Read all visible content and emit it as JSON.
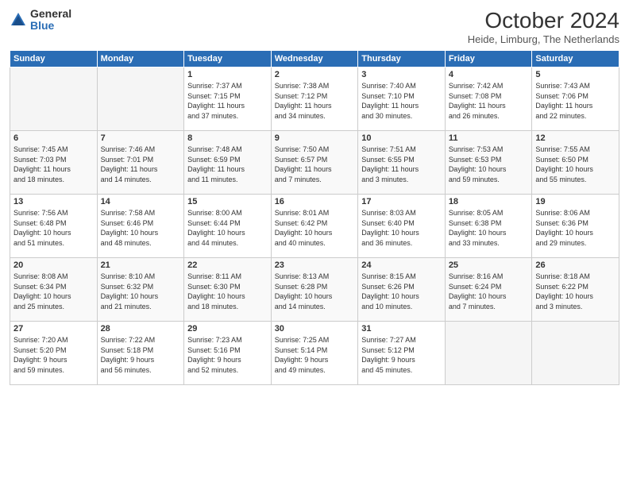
{
  "logo": {
    "general": "General",
    "blue": "Blue"
  },
  "title": "October 2024",
  "subtitle": "Heide, Limburg, The Netherlands",
  "headers": [
    "Sunday",
    "Monday",
    "Tuesday",
    "Wednesday",
    "Thursday",
    "Friday",
    "Saturday"
  ],
  "weeks": [
    [
      {
        "day": "",
        "info": ""
      },
      {
        "day": "",
        "info": ""
      },
      {
        "day": "1",
        "info": "Sunrise: 7:37 AM\nSunset: 7:15 PM\nDaylight: 11 hours\nand 37 minutes."
      },
      {
        "day": "2",
        "info": "Sunrise: 7:38 AM\nSunset: 7:12 PM\nDaylight: 11 hours\nand 34 minutes."
      },
      {
        "day": "3",
        "info": "Sunrise: 7:40 AM\nSunset: 7:10 PM\nDaylight: 11 hours\nand 30 minutes."
      },
      {
        "day": "4",
        "info": "Sunrise: 7:42 AM\nSunset: 7:08 PM\nDaylight: 11 hours\nand 26 minutes."
      },
      {
        "day": "5",
        "info": "Sunrise: 7:43 AM\nSunset: 7:06 PM\nDaylight: 11 hours\nand 22 minutes."
      }
    ],
    [
      {
        "day": "6",
        "info": "Sunrise: 7:45 AM\nSunset: 7:03 PM\nDaylight: 11 hours\nand 18 minutes."
      },
      {
        "day": "7",
        "info": "Sunrise: 7:46 AM\nSunset: 7:01 PM\nDaylight: 11 hours\nand 14 minutes."
      },
      {
        "day": "8",
        "info": "Sunrise: 7:48 AM\nSunset: 6:59 PM\nDaylight: 11 hours\nand 11 minutes."
      },
      {
        "day": "9",
        "info": "Sunrise: 7:50 AM\nSunset: 6:57 PM\nDaylight: 11 hours\nand 7 minutes."
      },
      {
        "day": "10",
        "info": "Sunrise: 7:51 AM\nSunset: 6:55 PM\nDaylight: 11 hours\nand 3 minutes."
      },
      {
        "day": "11",
        "info": "Sunrise: 7:53 AM\nSunset: 6:53 PM\nDaylight: 10 hours\nand 59 minutes."
      },
      {
        "day": "12",
        "info": "Sunrise: 7:55 AM\nSunset: 6:50 PM\nDaylight: 10 hours\nand 55 minutes."
      }
    ],
    [
      {
        "day": "13",
        "info": "Sunrise: 7:56 AM\nSunset: 6:48 PM\nDaylight: 10 hours\nand 51 minutes."
      },
      {
        "day": "14",
        "info": "Sunrise: 7:58 AM\nSunset: 6:46 PM\nDaylight: 10 hours\nand 48 minutes."
      },
      {
        "day": "15",
        "info": "Sunrise: 8:00 AM\nSunset: 6:44 PM\nDaylight: 10 hours\nand 44 minutes."
      },
      {
        "day": "16",
        "info": "Sunrise: 8:01 AM\nSunset: 6:42 PM\nDaylight: 10 hours\nand 40 minutes."
      },
      {
        "day": "17",
        "info": "Sunrise: 8:03 AM\nSunset: 6:40 PM\nDaylight: 10 hours\nand 36 minutes."
      },
      {
        "day": "18",
        "info": "Sunrise: 8:05 AM\nSunset: 6:38 PM\nDaylight: 10 hours\nand 33 minutes."
      },
      {
        "day": "19",
        "info": "Sunrise: 8:06 AM\nSunset: 6:36 PM\nDaylight: 10 hours\nand 29 minutes."
      }
    ],
    [
      {
        "day": "20",
        "info": "Sunrise: 8:08 AM\nSunset: 6:34 PM\nDaylight: 10 hours\nand 25 minutes."
      },
      {
        "day": "21",
        "info": "Sunrise: 8:10 AM\nSunset: 6:32 PM\nDaylight: 10 hours\nand 21 minutes."
      },
      {
        "day": "22",
        "info": "Sunrise: 8:11 AM\nSunset: 6:30 PM\nDaylight: 10 hours\nand 18 minutes."
      },
      {
        "day": "23",
        "info": "Sunrise: 8:13 AM\nSunset: 6:28 PM\nDaylight: 10 hours\nand 14 minutes."
      },
      {
        "day": "24",
        "info": "Sunrise: 8:15 AM\nSunset: 6:26 PM\nDaylight: 10 hours\nand 10 minutes."
      },
      {
        "day": "25",
        "info": "Sunrise: 8:16 AM\nSunset: 6:24 PM\nDaylight: 10 hours\nand 7 minutes."
      },
      {
        "day": "26",
        "info": "Sunrise: 8:18 AM\nSunset: 6:22 PM\nDaylight: 10 hours\nand 3 minutes."
      }
    ],
    [
      {
        "day": "27",
        "info": "Sunrise: 7:20 AM\nSunset: 5:20 PM\nDaylight: 9 hours\nand 59 minutes."
      },
      {
        "day": "28",
        "info": "Sunrise: 7:22 AM\nSunset: 5:18 PM\nDaylight: 9 hours\nand 56 minutes."
      },
      {
        "day": "29",
        "info": "Sunrise: 7:23 AM\nSunset: 5:16 PM\nDaylight: 9 hours\nand 52 minutes."
      },
      {
        "day": "30",
        "info": "Sunrise: 7:25 AM\nSunset: 5:14 PM\nDaylight: 9 hours\nand 49 minutes."
      },
      {
        "day": "31",
        "info": "Sunrise: 7:27 AM\nSunset: 5:12 PM\nDaylight: 9 hours\nand 45 minutes."
      },
      {
        "day": "",
        "info": ""
      },
      {
        "day": "",
        "info": ""
      }
    ]
  ]
}
